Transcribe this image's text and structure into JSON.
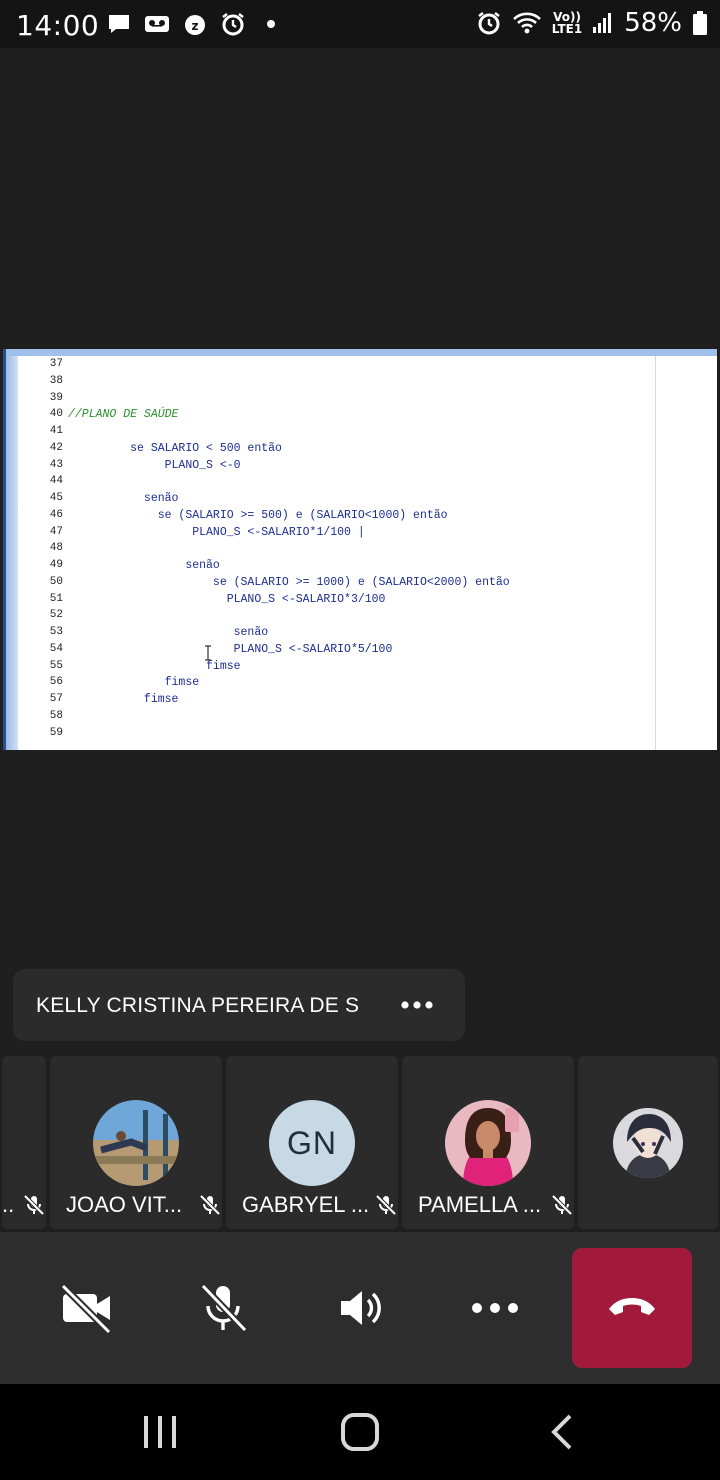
{
  "status_bar": {
    "time": "14:00",
    "battery_percent": "58%",
    "network_label_top": "Vo))",
    "network_label_bottom": "LTE1",
    "left_icons": [
      "message-icon",
      "voicemail-icon",
      "sleep-alarm-icon",
      "alarm-icon",
      "dot-icon"
    ],
    "right_icons": [
      "alarm-icon",
      "wifi-icon",
      "signal-icon",
      "battery-icon"
    ]
  },
  "shared_screen": {
    "code_lines": [
      {
        "ln": "37",
        "text": ""
      },
      {
        "ln": "38",
        "text": ""
      },
      {
        "ln": "39",
        "text": ""
      },
      {
        "ln": "40",
        "text": "//PLANO DE SAÚDE"
      },
      {
        "ln": "41",
        "text": ""
      },
      {
        "ln": "42",
        "text": "         se SALARIO < 500 então"
      },
      {
        "ln": "43",
        "text": "              PLANO_S <-0"
      },
      {
        "ln": "44",
        "text": ""
      },
      {
        "ln": "45",
        "text": "           senão"
      },
      {
        "ln": "46",
        "text": "             se (SALARIO >= 500) e (SALARIO<1000) então"
      },
      {
        "ln": "47",
        "text": "                  PLANO_S <-SALARIO*1/100 |"
      },
      {
        "ln": "48",
        "text": ""
      },
      {
        "ln": "49",
        "text": "                 senão"
      },
      {
        "ln": "50",
        "text": "                     se (SALARIO >= 1000) e (SALARIO<2000) então"
      },
      {
        "ln": "51",
        "text": "                       PLANO_S <-SALARIO*3/100"
      },
      {
        "ln": "52",
        "text": ""
      },
      {
        "ln": "53",
        "text": "                        senão"
      },
      {
        "ln": "54",
        "text": "                        PLANO_S <-SALARIO*5/100"
      },
      {
        "ln": "55",
        "text": "                    fimse"
      },
      {
        "ln": "56",
        "text": "              fimse"
      },
      {
        "ln": "57",
        "text": "           fimse"
      },
      {
        "ln": "58",
        "text": ""
      },
      {
        "ln": "59",
        "text": ""
      }
    ]
  },
  "presenter": {
    "name": "KELLY CRISTINA PEREIRA DE S",
    "more_icon": "more-dots-icon"
  },
  "participants": [
    {
      "name": "JOAO VIT...",
      "muted": true,
      "avatar": "photo"
    },
    {
      "name": "GABRYEL ...",
      "muted": true,
      "avatar": "initials",
      "initials": "GN"
    },
    {
      "name": "PAMELLA ...",
      "muted": true,
      "avatar": "photo"
    },
    {
      "name": "",
      "muted": false,
      "avatar": "photo"
    }
  ],
  "controls": {
    "camera": "camera-off-icon",
    "mic": "mic-off-icon",
    "speaker": "speaker-icon",
    "more": "more-dots-icon",
    "end_call": "end-call-icon",
    "end_call_color": "#a21a3b"
  },
  "nav": [
    "recents-icon",
    "home-icon",
    "back-icon"
  ]
}
